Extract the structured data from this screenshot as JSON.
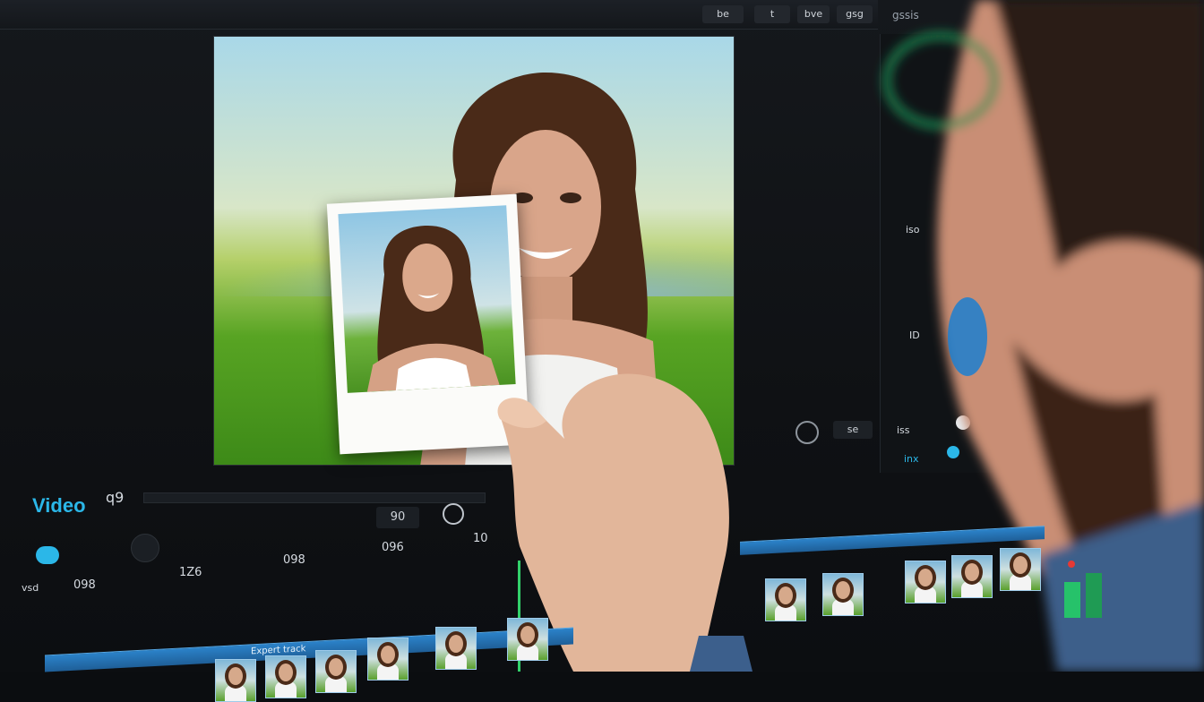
{
  "app": {
    "top_buttons": [
      "be",
      "t",
      "bve",
      "gsg"
    ],
    "top_right_text": "gssis",
    "section_label": "Video",
    "section_code": "q9"
  },
  "timeline": {
    "transport_left": "90",
    "timecodes": [
      "1Z6",
      "098",
      "096",
      "10"
    ],
    "track_label": "vsd",
    "track_value": "098",
    "track_title": "Expert track"
  },
  "side_panel": {
    "labels": [
      "iso",
      "ID",
      "iss",
      "inx",
      "se"
    ]
  },
  "colors": {
    "accent": "#2bb7e8",
    "timeline_bar": "#2b82c9",
    "playhead": "#32d06a"
  }
}
